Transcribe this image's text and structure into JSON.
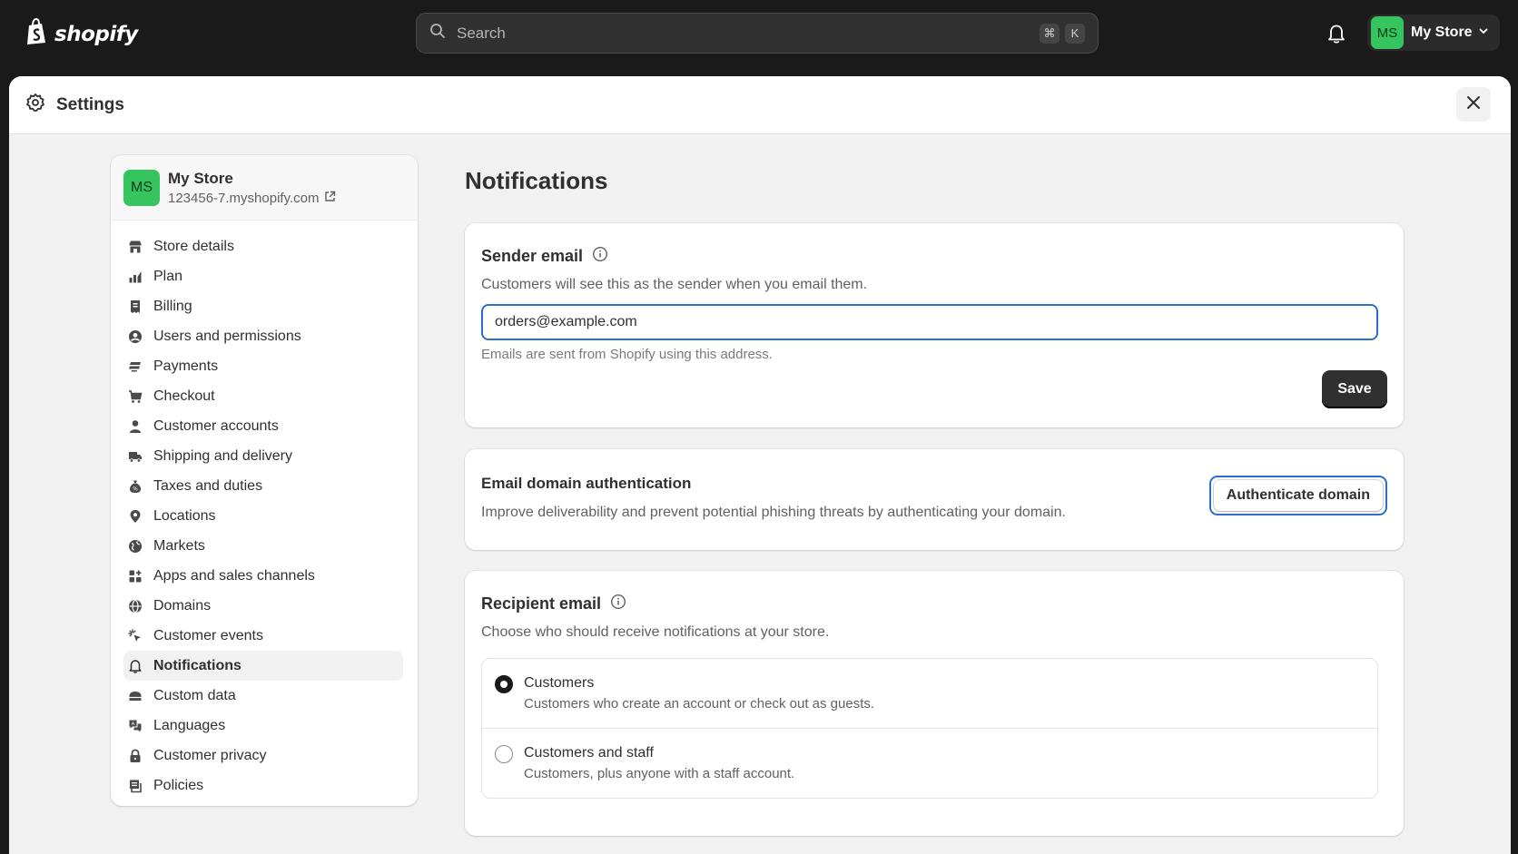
{
  "topbar": {
    "brand": "shopify",
    "search_placeholder": "Search",
    "shortcut_keys": [
      "⌘",
      "K"
    ],
    "account_initials": "MS",
    "account_name": "My Store"
  },
  "modal": {
    "title": "Settings"
  },
  "sidebar": {
    "store": {
      "initials": "MS",
      "name": "My Store",
      "domain": "123456-7.myshopify.com"
    },
    "items": [
      {
        "label": "Store details",
        "icon": "store-icon"
      },
      {
        "label": "Plan",
        "icon": "plan-icon"
      },
      {
        "label": "Billing",
        "icon": "billing-icon"
      },
      {
        "label": "Users and permissions",
        "icon": "user-circle-icon"
      },
      {
        "label": "Payments",
        "icon": "payments-icon"
      },
      {
        "label": "Checkout",
        "icon": "cart-icon"
      },
      {
        "label": "Customer accounts",
        "icon": "person-icon"
      },
      {
        "label": "Shipping and delivery",
        "icon": "truck-icon"
      },
      {
        "label": "Taxes and duties",
        "icon": "tax-icon"
      },
      {
        "label": "Locations",
        "icon": "location-icon"
      },
      {
        "label": "Markets",
        "icon": "globe-icon"
      },
      {
        "label": "Apps and sales channels",
        "icon": "apps-icon"
      },
      {
        "label": "Domains",
        "icon": "globe-icon"
      },
      {
        "label": "Customer events",
        "icon": "cursor-icon"
      },
      {
        "label": "Notifications",
        "icon": "bell-icon",
        "active": true
      },
      {
        "label": "Custom data",
        "icon": "database-icon"
      },
      {
        "label": "Languages",
        "icon": "language-icon"
      },
      {
        "label": "Customer privacy",
        "icon": "lock-icon"
      },
      {
        "label": "Policies",
        "icon": "policy-icon"
      }
    ]
  },
  "main": {
    "title": "Notifications",
    "sender_email": {
      "heading": "Sender email",
      "description": "Customers will see this as the sender when you email them.",
      "value": "orders@example.com",
      "help": "Emails are sent from Shopify using this address.",
      "save_label": "Save"
    },
    "domain_auth": {
      "heading": "Email domain authentication",
      "description": "Improve deliverability and prevent potential phishing threats by authenticating your domain.",
      "button_label": "Authenticate domain"
    },
    "recipient_email": {
      "heading": "Recipient email",
      "description": "Choose who should receive notifications at your store.",
      "options": [
        {
          "label": "Customers",
          "description": "Customers who create an account or check out as guests.",
          "selected": true
        },
        {
          "label": "Customers and staff",
          "description": "Customers, plus anyone with a staff account.",
          "selected": false
        }
      ]
    }
  },
  "colors": {
    "topbar_bg": "#1a1a1a",
    "avatar_green": "#36c45f",
    "focus_blue": "#2c6ecb",
    "primary_button": "#303030"
  }
}
